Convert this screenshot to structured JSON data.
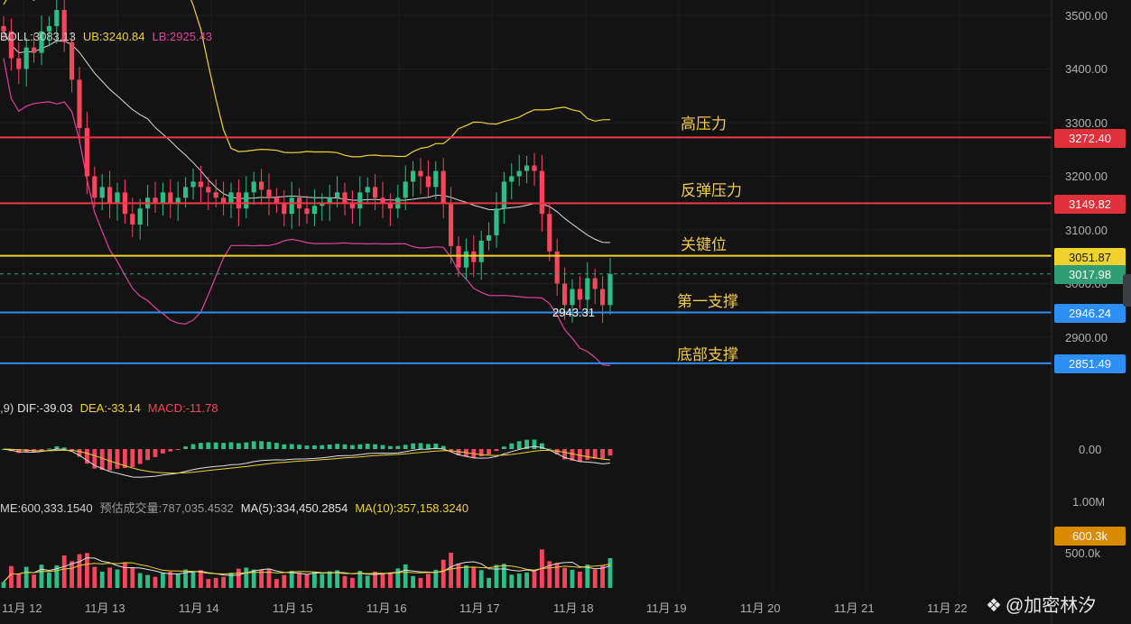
{
  "indicators": {
    "boll": {
      "label": "BOLL:3083.13",
      "ub": "UB:3240.84",
      "lb": "LB:2925.43"
    },
    "macd": {
      "prefix": ",9)",
      "dif": "DIF:-39.03",
      "dea": "DEA:-33.14",
      "macd": "MACD:-11.78"
    },
    "volume": {
      "vol": "ME:600,333.1540",
      "est": "预估成交量:787,035.4532",
      "ma5": "MA(5):334,450.2854",
      "ma10": "MA(10):357,158.3240"
    }
  },
  "price_tags": {
    "high_resistance": "3272.40",
    "rebound_resistance": "3149.82",
    "key_level": "3051.87",
    "current": "3017.98",
    "first_support": "2946.24",
    "bottom_support": "2851.49",
    "volume_current": "600.3k"
  },
  "annotations": {
    "high_resistance": "高压力",
    "rebound_resistance": "反弹压力",
    "key_level": "关键位",
    "first_support": "第一支撑",
    "bottom_support": "底部支撑",
    "low_marker": "2943.31"
  },
  "axes": {
    "price_ticks": [
      "3500.00",
      "3400.00",
      "3300.00",
      "3200.00",
      "3100.00",
      "3000.00",
      "2900.00"
    ],
    "macd_ticks": [
      "0.00"
    ],
    "volume_ticks": [
      "1.00M",
      "500.0k"
    ],
    "dates": [
      "11月 12",
      "11月 13",
      "11月 14",
      "11月 15",
      "11月 16",
      "11月 17",
      "11月 18",
      "11月 19",
      "11月 20",
      "11月 21",
      "11月 22"
    ]
  },
  "watermark": "@加密林汐",
  "colors": {
    "up": "#2ebd85",
    "down": "#f6465d",
    "red_line": "#f23645",
    "yellow_line": "#f0d22c",
    "blue_line": "#2e8ef7",
    "boll_ub": "#f0d22c",
    "boll_lb": "#e040a0",
    "boll_mid": "#d9d9d9"
  },
  "chart_data": {
    "type": "candlestick",
    "x": [
      "11月 12",
      "11月 13",
      "11月 14",
      "11月 15",
      "11月 16",
      "11月 17",
      "11月 18"
    ],
    "price_range": [
      2860,
      3520
    ],
    "closes": [
      3470,
      3420,
      3400,
      3440,
      3430,
      3470,
      3480,
      3510,
      3450,
      3380,
      3290,
      3200,
      3160,
      3180,
      3150,
      3170,
      3130,
      3110,
      3140,
      3160,
      3150,
      3170,
      3150,
      3160,
      3180,
      3190,
      3180,
      3170,
      3160,
      3150,
      3170,
      3140,
      3170,
      3190,
      3175,
      3160,
      3150,
      3130,
      3160,
      3140,
      3130,
      3145,
      3150,
      3160,
      3170,
      3150,
      3140,
      3170,
      3180,
      3160,
      3150,
      3140,
      3160,
      3190,
      3210,
      3200,
      3180,
      3210,
      3150,
      3070,
      3030,
      3060,
      3040,
      3080,
      3090,
      3140,
      3190,
      3200,
      3210,
      3220,
      3210,
      3130,
      3060,
      3000,
      2960,
      2990,
      2970,
      3010,
      2990,
      2960,
      3017.98
    ],
    "horizontal_levels": [
      {
        "name": "高压力",
        "value": 3272.4
      },
      {
        "name": "反弹压力",
        "value": 3149.82
      },
      {
        "name": "关键位",
        "value": 3051.87
      },
      {
        "name": "第一支撑",
        "value": 2946.24
      },
      {
        "name": "底部支撑",
        "value": 2851.49
      }
    ],
    "current_price": 3017.98,
    "low_marker": 2943.31,
    "boll": {
      "mid": 3083.13,
      "ub": 3240.84,
      "lb": 2925.43
    },
    "macd": {
      "dif": -39.03,
      "dea": -33.14,
      "macd": -11.78
    },
    "volume": {
      "current": 600333.154,
      "ma5": 334450.2854,
      "ma10": 357158.324
    }
  }
}
